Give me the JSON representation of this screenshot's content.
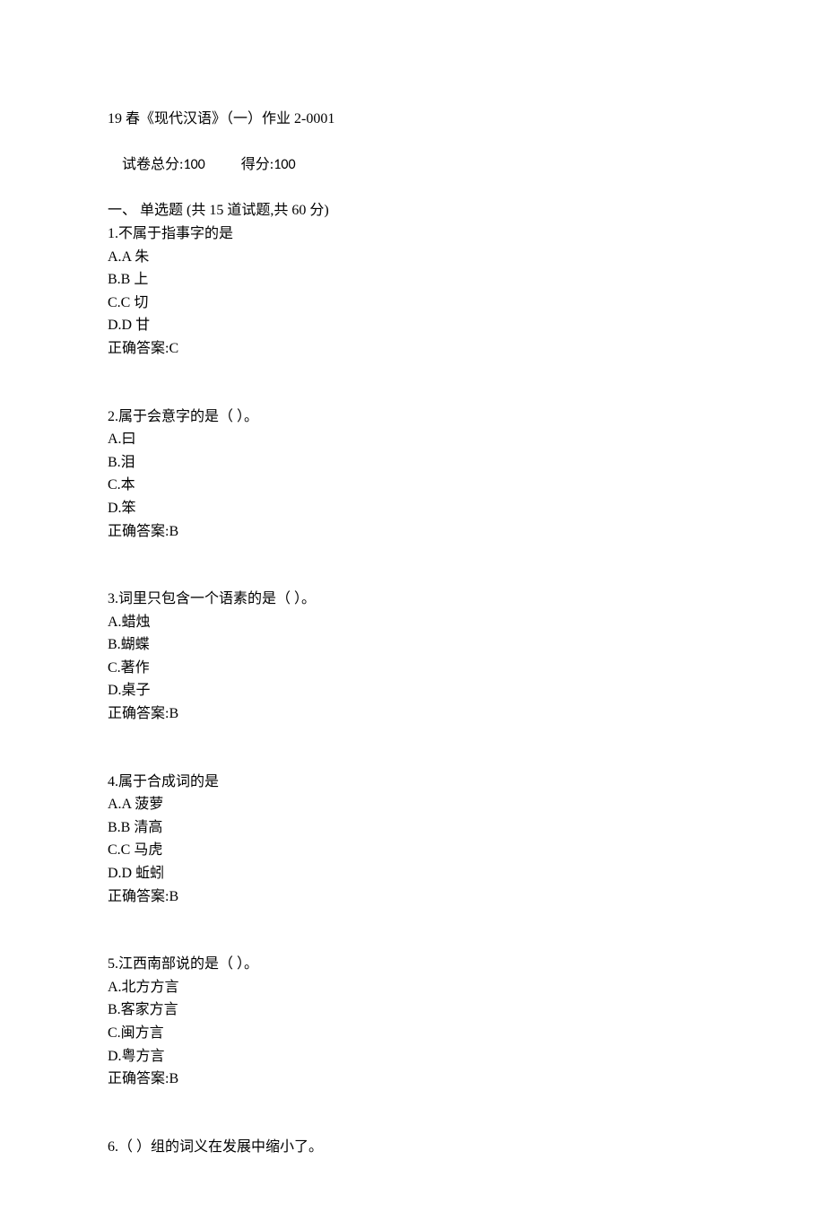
{
  "header": {
    "title_line": "19 春《现代汉语》（一）作业 2-0001",
    "score_label": "试卷总分:",
    "score_total": "100",
    "score_got_label": "得分:",
    "score_got": "100",
    "section_line": "一、 单选题 (共 15 道试题,共 60 分)"
  },
  "questions": [
    {
      "stem": "1.不属于指事字的是",
      "options": [
        "A.A 朱",
        "B.B 上",
        "C.C 切",
        "D.D 甘"
      ],
      "answer": "正确答案:C"
    },
    {
      "stem": "2.属于会意字的是（ ）。",
      "options": [
        "A.曰",
        "B.泪",
        "C.本",
        "D.笨"
      ],
      "answer": "正确答案:B"
    },
    {
      "stem": "3.词里只包含一个语素的是（ ）。",
      "options": [
        "A.蜡烛",
        "B.蝴蝶",
        "C.著作",
        "D.桌子"
      ],
      "answer": "正确答案:B"
    },
    {
      "stem": "4.属于合成词的是",
      "options": [
        "A.A 菠萝",
        "B.B 清高",
        "C.C 马虎",
        "D.D 蚯蚓"
      ],
      "answer": "正确答案:B"
    },
    {
      "stem": "5.江西南部说的是（ ）。",
      "options": [
        "A.北方方言",
        "B.客家方言",
        "C.闽方言",
        "D.粤方言"
      ],
      "answer": "正确答案:B"
    },
    {
      "stem": "6.（ ）组的词义在发展中缩小了。",
      "options": [],
      "answer": ""
    }
  ]
}
